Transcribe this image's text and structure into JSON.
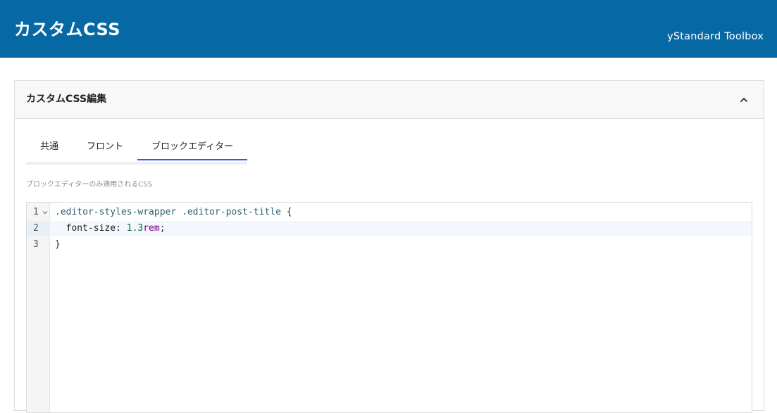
{
  "header": {
    "title": "カスタムCSS",
    "brand": "yStandard Toolbox"
  },
  "panel": {
    "title": "カスタムCSS編集",
    "toggle_icon": "chevron-up-icon"
  },
  "tabs": [
    {
      "label": "共通",
      "active": false
    },
    {
      "label": "フロント",
      "active": false
    },
    {
      "label": "ブロックエディター",
      "active": true
    }
  ],
  "hint": "ブロックエディターのみ適用されるCSS",
  "editor": {
    "lines": [
      {
        "num": "1",
        "selector": ".editor-styles-wrapper .editor-post-title",
        "rest": " {"
      },
      {
        "num": "2",
        "prop": "  font-size: ",
        "number": "1.3",
        "unit": "rem",
        "end": ";"
      },
      {
        "num": "3",
        "text": "}"
      }
    ],
    "active_line": 2
  },
  "colors": {
    "header_bg": "#0769a4",
    "tab_active": "#3858e9"
  }
}
